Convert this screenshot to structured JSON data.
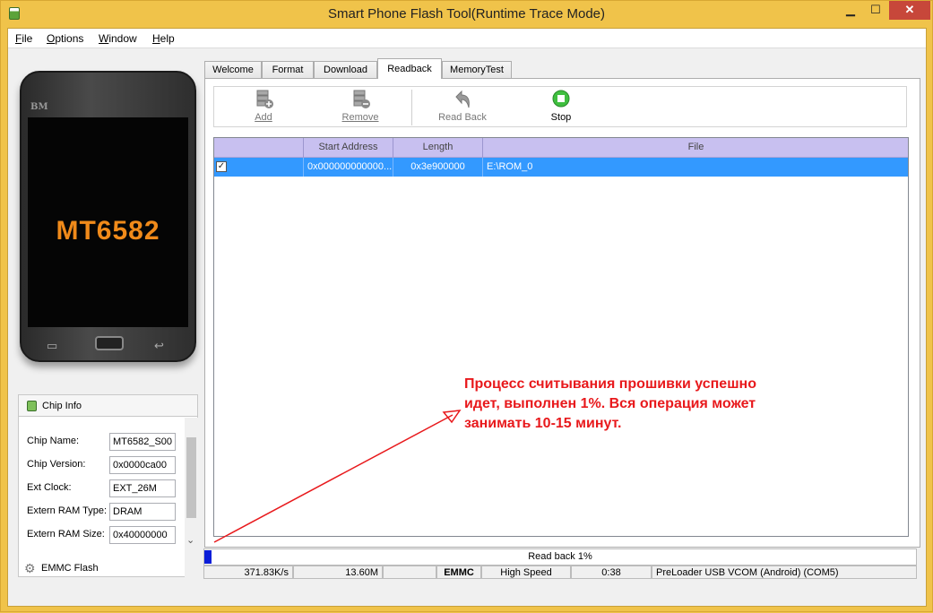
{
  "window": {
    "title": "Smart Phone Flash Tool(Runtime Trace Mode)",
    "minimize": "▁",
    "maximize": "☐",
    "close": "✕"
  },
  "menu": [
    {
      "u": "F",
      "rest": "ile"
    },
    {
      "u": "O",
      "rest": "ptions"
    },
    {
      "u": "W",
      "rest": "indow"
    },
    {
      "u": "H",
      "rest": "elp"
    }
  ],
  "phone": {
    "brand": "BM",
    "chip": "MT6582",
    "menu_key": "▭",
    "back_key": "↩"
  },
  "chip_info": {
    "header": "Chip Info",
    "rows": [
      {
        "label": "Chip Name:",
        "value": "MT6582_S00"
      },
      {
        "label": "Chip Version:",
        "value": "0x0000ca00"
      },
      {
        "label": "Ext Clock:",
        "value": "EXT_26M"
      },
      {
        "label": "Extern RAM Type:",
        "value": "DRAM"
      },
      {
        "label": "Extern RAM Size:",
        "value": "0x40000000"
      }
    ],
    "scroll_down": "⌄"
  },
  "emmc": {
    "label": "EMMC Flash",
    "icon": "⚙"
  },
  "tabs": [
    {
      "label": "Welcome"
    },
    {
      "label": "Format"
    },
    {
      "label": "Download"
    },
    {
      "label": "Readback"
    },
    {
      "label": "MemoryTest"
    }
  ],
  "toolbar": {
    "add": "Add",
    "remove": "Remove",
    "read_back": "Read Back",
    "stop": "Stop"
  },
  "table": {
    "columns": [
      "",
      "Start Address",
      "Length",
      "File"
    ],
    "rows": [
      {
        "checked": "✓",
        "start_address": "0x000000000000...",
        "length": "0x3e900000",
        "file": "E:\\ROM_0"
      }
    ]
  },
  "progress": {
    "text": "Read back 1%",
    "percent": 1,
    "fill_color": "#0a1dd8"
  },
  "status": {
    "speed": "371.83K/s",
    "size": "13.60M",
    "blank": "",
    "storage": "EMMC",
    "usb_speed": "High Speed",
    "time": "0:38",
    "port": "PreLoader USB VCOM (Android) (COM5)"
  },
  "annotation": {
    "line1": "Процесс считывания прошивки успешно",
    "line2": "идет, выполнен 1%. Вся операция может",
    "line3": "занимать 10-15 минут.",
    "color": "#e8191c"
  }
}
